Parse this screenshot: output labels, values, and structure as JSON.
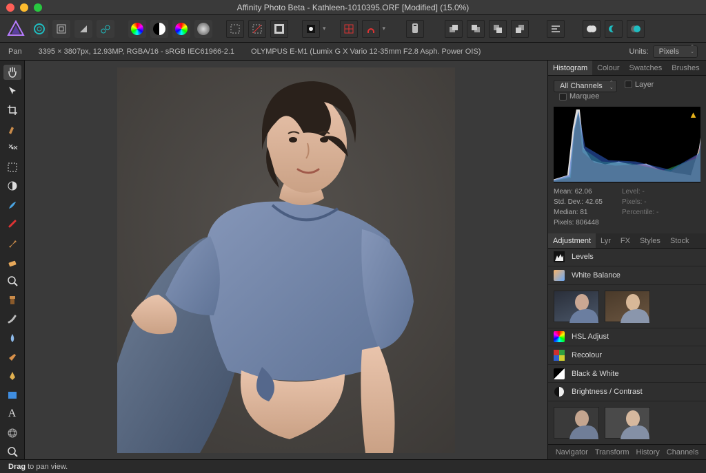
{
  "title": "Affinity Photo Beta - Kathleen-1010395.ORF [Modified] (15.0%)",
  "info": {
    "tool": "Pan",
    "dims": "3395 × 3807px, 12.93MP, RGBA/16 - sRGB IEC61966-2.1",
    "camera": "OLYMPUS E-M1 (Lumix G X Vario 12-35mm F2.8 Asph. Power OIS)",
    "units_label": "Units:",
    "units_value": "Pixels"
  },
  "status": {
    "prefix": "Drag",
    "rest": " to pan view."
  },
  "tabs1": {
    "histogram": "Histogram",
    "colour": "Colour",
    "swatches": "Swatches",
    "brushes": "Brushes"
  },
  "histo_panel": {
    "channels": "All Channels",
    "layer": "Layer",
    "marquee": "Marquee",
    "stats": {
      "mean_l": "Mean:",
      "mean_v": "62.06",
      "sd_l": "Std. Dev.:",
      "sd_v": "42.65",
      "median_l": "Median:",
      "median_v": "81",
      "pixels_l": "Pixels:",
      "pixels_v": "806448",
      "level_l": "Level:",
      "level_v": "-",
      "px2_l": "Pixels:",
      "px2_v": "-",
      "perc_l": "Percentile:",
      "perc_v": "-"
    }
  },
  "tabs2": {
    "adjustment": "Adjustment",
    "lyr": "Lyr",
    "fx": "FX",
    "styles": "Styles",
    "stock": "Stock"
  },
  "adjustments": {
    "levels": "Levels",
    "wb": "White Balance",
    "hsl": "HSL Adjust",
    "recolour": "Recolour",
    "bw": "Black & White",
    "bc": "Brightness / Contrast"
  },
  "tabs3": {
    "navigator": "Navigator",
    "transform": "Transform",
    "history": "History",
    "channels": "Channels"
  }
}
